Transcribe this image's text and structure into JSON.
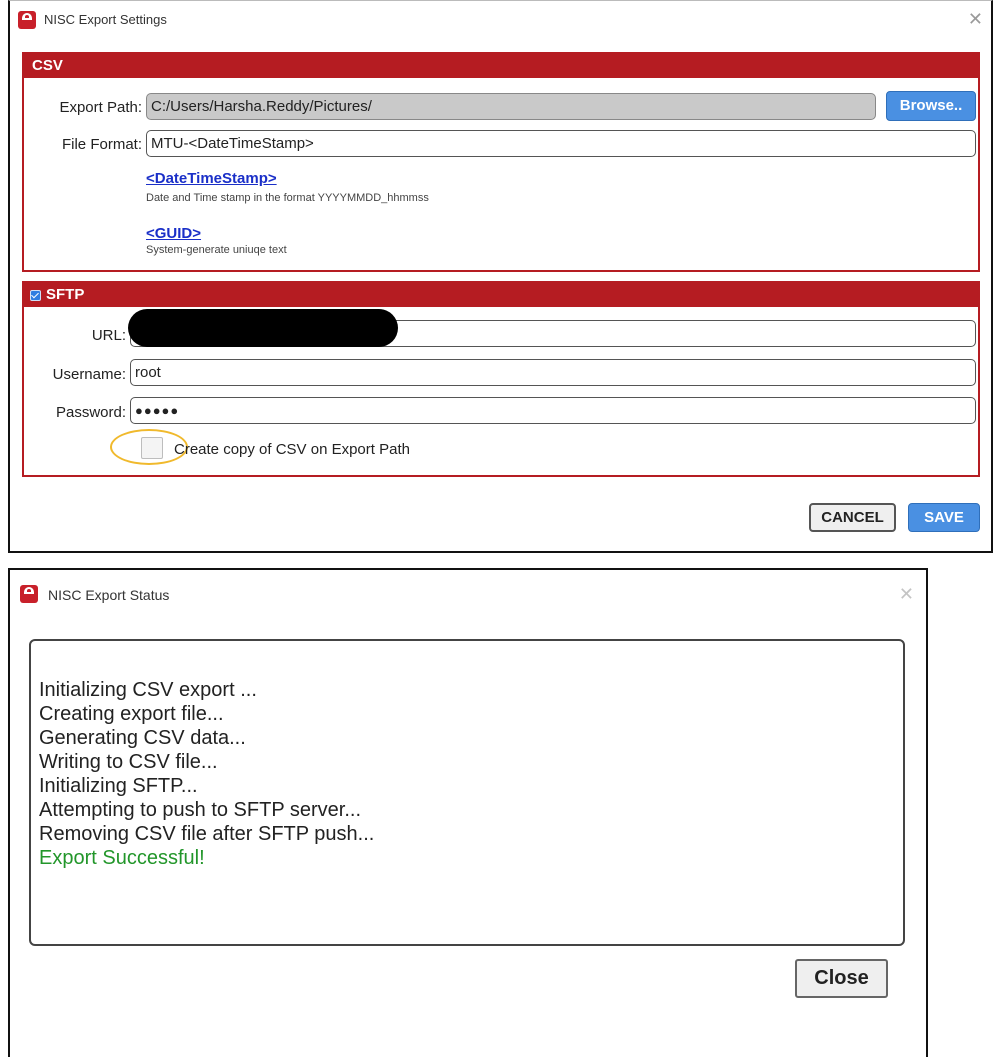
{
  "settings_window": {
    "title": "NISC Export Settings",
    "close_icon": "close-icon",
    "csv": {
      "header": "CSV",
      "export_path_label": "Export Path:",
      "export_path_value": "C:/Users/Harsha.Reddy/Pictures/",
      "browse_label": "Browse..",
      "file_format_label": "File Format:",
      "file_format_value": "MTU-<DateTimeStamp>",
      "tokens": [
        {
          "name": "<DateTimeStamp>",
          "description": "Date and Time stamp in the format YYYYMMDD_hhmmss"
        },
        {
          "name": "<GUID>",
          "description": "System-generate uniuqe text"
        }
      ]
    },
    "sftp": {
      "header": "SFTP",
      "enabled": true,
      "url_label": "URL:",
      "url_value": "",
      "username_label": "Username:",
      "username_value": "root",
      "password_label": "Password:",
      "password_value": "●●●●●",
      "copy_checkbox_label": "Create copy of CSV on Export Path",
      "copy_checkbox_checked": false
    },
    "cancel_label": "CANCEL",
    "save_label": "SAVE"
  },
  "status_window": {
    "title": "NISC Export Status",
    "lines": [
      "Initializing CSV export ...",
      "Creating export file...",
      "Generating CSV data...",
      "Writing to CSV file...",
      "Initializing SFTP...",
      "Attempting to push to SFTP server...",
      "Removing CSV file after SFTP push..."
    ],
    "success_line": "Export Successful!",
    "close_label": "Close"
  },
  "colors": {
    "panel_red": "#b51c22",
    "accent_blue": "#4a90e2",
    "link_blue": "#1a2fc8",
    "success_green": "#22962a",
    "highlight_orange": "#f0b92c"
  }
}
